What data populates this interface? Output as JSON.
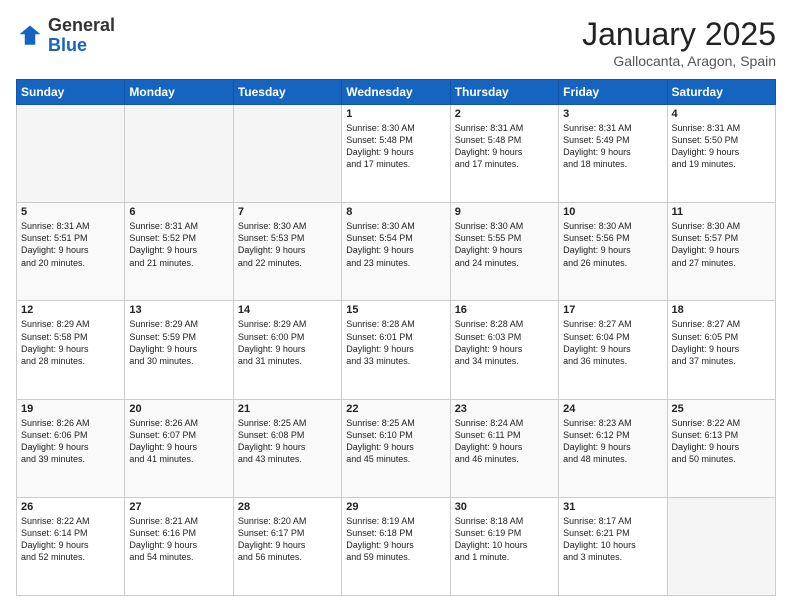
{
  "header": {
    "logo_general": "General",
    "logo_blue": "Blue",
    "month": "January 2025",
    "location": "Gallocanta, Aragon, Spain"
  },
  "weekdays": [
    "Sunday",
    "Monday",
    "Tuesday",
    "Wednesday",
    "Thursday",
    "Friday",
    "Saturday"
  ],
  "weeks": [
    [
      {
        "num": "",
        "text": ""
      },
      {
        "num": "",
        "text": ""
      },
      {
        "num": "",
        "text": ""
      },
      {
        "num": "1",
        "text": "Sunrise: 8:30 AM\nSunset: 5:48 PM\nDaylight: 9 hours\nand 17 minutes."
      },
      {
        "num": "2",
        "text": "Sunrise: 8:31 AM\nSunset: 5:48 PM\nDaylight: 9 hours\nand 17 minutes."
      },
      {
        "num": "3",
        "text": "Sunrise: 8:31 AM\nSunset: 5:49 PM\nDaylight: 9 hours\nand 18 minutes."
      },
      {
        "num": "4",
        "text": "Sunrise: 8:31 AM\nSunset: 5:50 PM\nDaylight: 9 hours\nand 19 minutes."
      }
    ],
    [
      {
        "num": "5",
        "text": "Sunrise: 8:31 AM\nSunset: 5:51 PM\nDaylight: 9 hours\nand 20 minutes."
      },
      {
        "num": "6",
        "text": "Sunrise: 8:31 AM\nSunset: 5:52 PM\nDaylight: 9 hours\nand 21 minutes."
      },
      {
        "num": "7",
        "text": "Sunrise: 8:30 AM\nSunset: 5:53 PM\nDaylight: 9 hours\nand 22 minutes."
      },
      {
        "num": "8",
        "text": "Sunrise: 8:30 AM\nSunset: 5:54 PM\nDaylight: 9 hours\nand 23 minutes."
      },
      {
        "num": "9",
        "text": "Sunrise: 8:30 AM\nSunset: 5:55 PM\nDaylight: 9 hours\nand 24 minutes."
      },
      {
        "num": "10",
        "text": "Sunrise: 8:30 AM\nSunset: 5:56 PM\nDaylight: 9 hours\nand 26 minutes."
      },
      {
        "num": "11",
        "text": "Sunrise: 8:30 AM\nSunset: 5:57 PM\nDaylight: 9 hours\nand 27 minutes."
      }
    ],
    [
      {
        "num": "12",
        "text": "Sunrise: 8:29 AM\nSunset: 5:58 PM\nDaylight: 9 hours\nand 28 minutes."
      },
      {
        "num": "13",
        "text": "Sunrise: 8:29 AM\nSunset: 5:59 PM\nDaylight: 9 hours\nand 30 minutes."
      },
      {
        "num": "14",
        "text": "Sunrise: 8:29 AM\nSunset: 6:00 PM\nDaylight: 9 hours\nand 31 minutes."
      },
      {
        "num": "15",
        "text": "Sunrise: 8:28 AM\nSunset: 6:01 PM\nDaylight: 9 hours\nand 33 minutes."
      },
      {
        "num": "16",
        "text": "Sunrise: 8:28 AM\nSunset: 6:03 PM\nDaylight: 9 hours\nand 34 minutes."
      },
      {
        "num": "17",
        "text": "Sunrise: 8:27 AM\nSunset: 6:04 PM\nDaylight: 9 hours\nand 36 minutes."
      },
      {
        "num": "18",
        "text": "Sunrise: 8:27 AM\nSunset: 6:05 PM\nDaylight: 9 hours\nand 37 minutes."
      }
    ],
    [
      {
        "num": "19",
        "text": "Sunrise: 8:26 AM\nSunset: 6:06 PM\nDaylight: 9 hours\nand 39 minutes."
      },
      {
        "num": "20",
        "text": "Sunrise: 8:26 AM\nSunset: 6:07 PM\nDaylight: 9 hours\nand 41 minutes."
      },
      {
        "num": "21",
        "text": "Sunrise: 8:25 AM\nSunset: 6:08 PM\nDaylight: 9 hours\nand 43 minutes."
      },
      {
        "num": "22",
        "text": "Sunrise: 8:25 AM\nSunset: 6:10 PM\nDaylight: 9 hours\nand 45 minutes."
      },
      {
        "num": "23",
        "text": "Sunrise: 8:24 AM\nSunset: 6:11 PM\nDaylight: 9 hours\nand 46 minutes."
      },
      {
        "num": "24",
        "text": "Sunrise: 8:23 AM\nSunset: 6:12 PM\nDaylight: 9 hours\nand 48 minutes."
      },
      {
        "num": "25",
        "text": "Sunrise: 8:22 AM\nSunset: 6:13 PM\nDaylight: 9 hours\nand 50 minutes."
      }
    ],
    [
      {
        "num": "26",
        "text": "Sunrise: 8:22 AM\nSunset: 6:14 PM\nDaylight: 9 hours\nand 52 minutes."
      },
      {
        "num": "27",
        "text": "Sunrise: 8:21 AM\nSunset: 6:16 PM\nDaylight: 9 hours\nand 54 minutes."
      },
      {
        "num": "28",
        "text": "Sunrise: 8:20 AM\nSunset: 6:17 PM\nDaylight: 9 hours\nand 56 minutes."
      },
      {
        "num": "29",
        "text": "Sunrise: 8:19 AM\nSunset: 6:18 PM\nDaylight: 9 hours\nand 59 minutes."
      },
      {
        "num": "30",
        "text": "Sunrise: 8:18 AM\nSunset: 6:19 PM\nDaylight: 10 hours\nand 1 minute."
      },
      {
        "num": "31",
        "text": "Sunrise: 8:17 AM\nSunset: 6:21 PM\nDaylight: 10 hours\nand 3 minutes."
      },
      {
        "num": "",
        "text": ""
      }
    ]
  ]
}
